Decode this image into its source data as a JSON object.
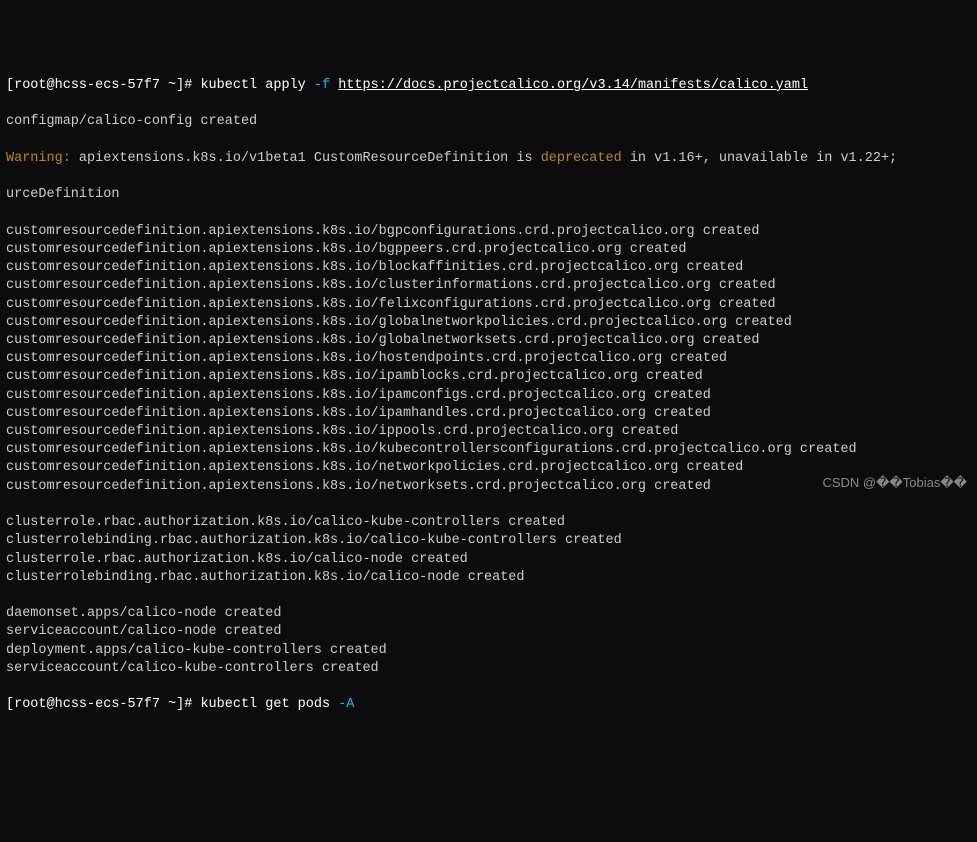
{
  "prompt1": {
    "open": "[",
    "user": "root@hcss-ecs-57f7 ~",
    "close": "]#",
    "cmd": "kubectl apply",
    "flag": "-f",
    "url": "https://docs.projectcalico.org/v3.14/manifests/calico.yaml"
  },
  "line_configmap": "configmap/calico-config created",
  "warning_label": "Warning:",
  "warning_text1": " apiextensions.k8s.io/v1beta1 CustomResourceDefinition is ",
  "warning_deprecated": "deprecated",
  "warning_text2": " in v1.16+, unavailable in v1.22+;",
  "warning_cont": "urceDefinition",
  "crd_lines": [
    "customresourcedefinition.apiextensions.k8s.io/bgpconfigurations.crd.projectcalico.org created",
    "customresourcedefinition.apiextensions.k8s.io/bgppeers.crd.projectcalico.org created",
    "customresourcedefinition.apiextensions.k8s.io/blockaffinities.crd.projectcalico.org created",
    "customresourcedefinition.apiextensions.k8s.io/clusterinformations.crd.projectcalico.org created",
    "customresourcedefinition.apiextensions.k8s.io/felixconfigurations.crd.projectcalico.org created",
    "customresourcedefinition.apiextensions.k8s.io/globalnetworkpolicies.crd.projectcalico.org created",
    "customresourcedefinition.apiextensions.k8s.io/globalnetworksets.crd.projectcalico.org created",
    "customresourcedefinition.apiextensions.k8s.io/hostendpoints.crd.projectcalico.org created",
    "customresourcedefinition.apiextensions.k8s.io/ipamblocks.crd.projectcalico.org created",
    "customresourcedefinition.apiextensions.k8s.io/ipamconfigs.crd.projectcalico.org created",
    "customresourcedefinition.apiextensions.k8s.io/ipamhandles.crd.projectcalico.org created",
    "customresourcedefinition.apiextensions.k8s.io/ippools.crd.projectcalico.org created",
    "customresourcedefinition.apiextensions.k8s.io/kubecontrollersconfigurations.crd.projectcalico.org created",
    "customresourcedefinition.apiextensions.k8s.io/networkpolicies.crd.projectcalico.org created",
    "customresourcedefinition.apiextensions.k8s.io/networksets.crd.projectcalico.org created"
  ],
  "rbac_lines": [
    "clusterrole.rbac.authorization.k8s.io/calico-kube-controllers created",
    "clusterrolebinding.rbac.authorization.k8s.io/calico-kube-controllers created",
    "clusterrole.rbac.authorization.k8s.io/calico-node created",
    "clusterrolebinding.rbac.authorization.k8s.io/calico-node created"
  ],
  "other_lines": [
    "daemonset.apps/calico-node created",
    "serviceaccount/calico-node created",
    "deployment.apps/calico-kube-controllers created",
    "serviceaccount/calico-kube-controllers created"
  ],
  "prompt2": {
    "open": "[",
    "user": "root@hcss-ecs-57f7 ~",
    "close": "]#",
    "cmd": "kubectl get pods",
    "flag": "-A"
  },
  "watermark": "CSDN @��Tobias��"
}
